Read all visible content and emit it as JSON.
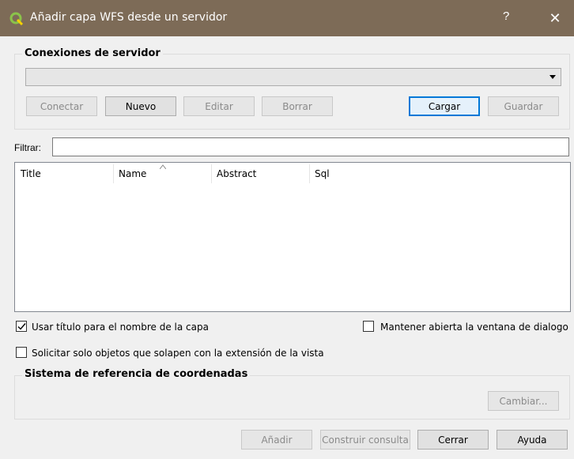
{
  "window": {
    "title": "Añadir capa WFS desde un servidor",
    "help_label": "?",
    "close_label": "✕"
  },
  "server_connections": {
    "group_title": "Conexiones de servidor",
    "selected_connection": "",
    "buttons": {
      "connect": "Conectar",
      "new": "Nuevo",
      "edit": "Editar",
      "delete": "Borrar",
      "load": "Cargar",
      "save": "Guardar"
    }
  },
  "filter": {
    "label": "Filtrar:",
    "value": ""
  },
  "table": {
    "columns": [
      "Title",
      "Name",
      "Abstract",
      "Sql"
    ],
    "rows": []
  },
  "options": {
    "use_title": {
      "label": "Usar título para el nombre de la capa",
      "checked": true
    },
    "keep_open": {
      "label": "Mantener abierta la ventana de dialogo",
      "checked": false
    },
    "only_overlapping": {
      "label": "Solicitar solo objetos que solapen con la extensión de la vista",
      "checked": false
    }
  },
  "crs": {
    "group_title": "Sistema de referencia de coordenadas",
    "change_button": "Cambiar..."
  },
  "footer": {
    "add": "Añadir",
    "build_query": "Construir consulta",
    "close": "Cerrar",
    "help": "Ayuda"
  }
}
